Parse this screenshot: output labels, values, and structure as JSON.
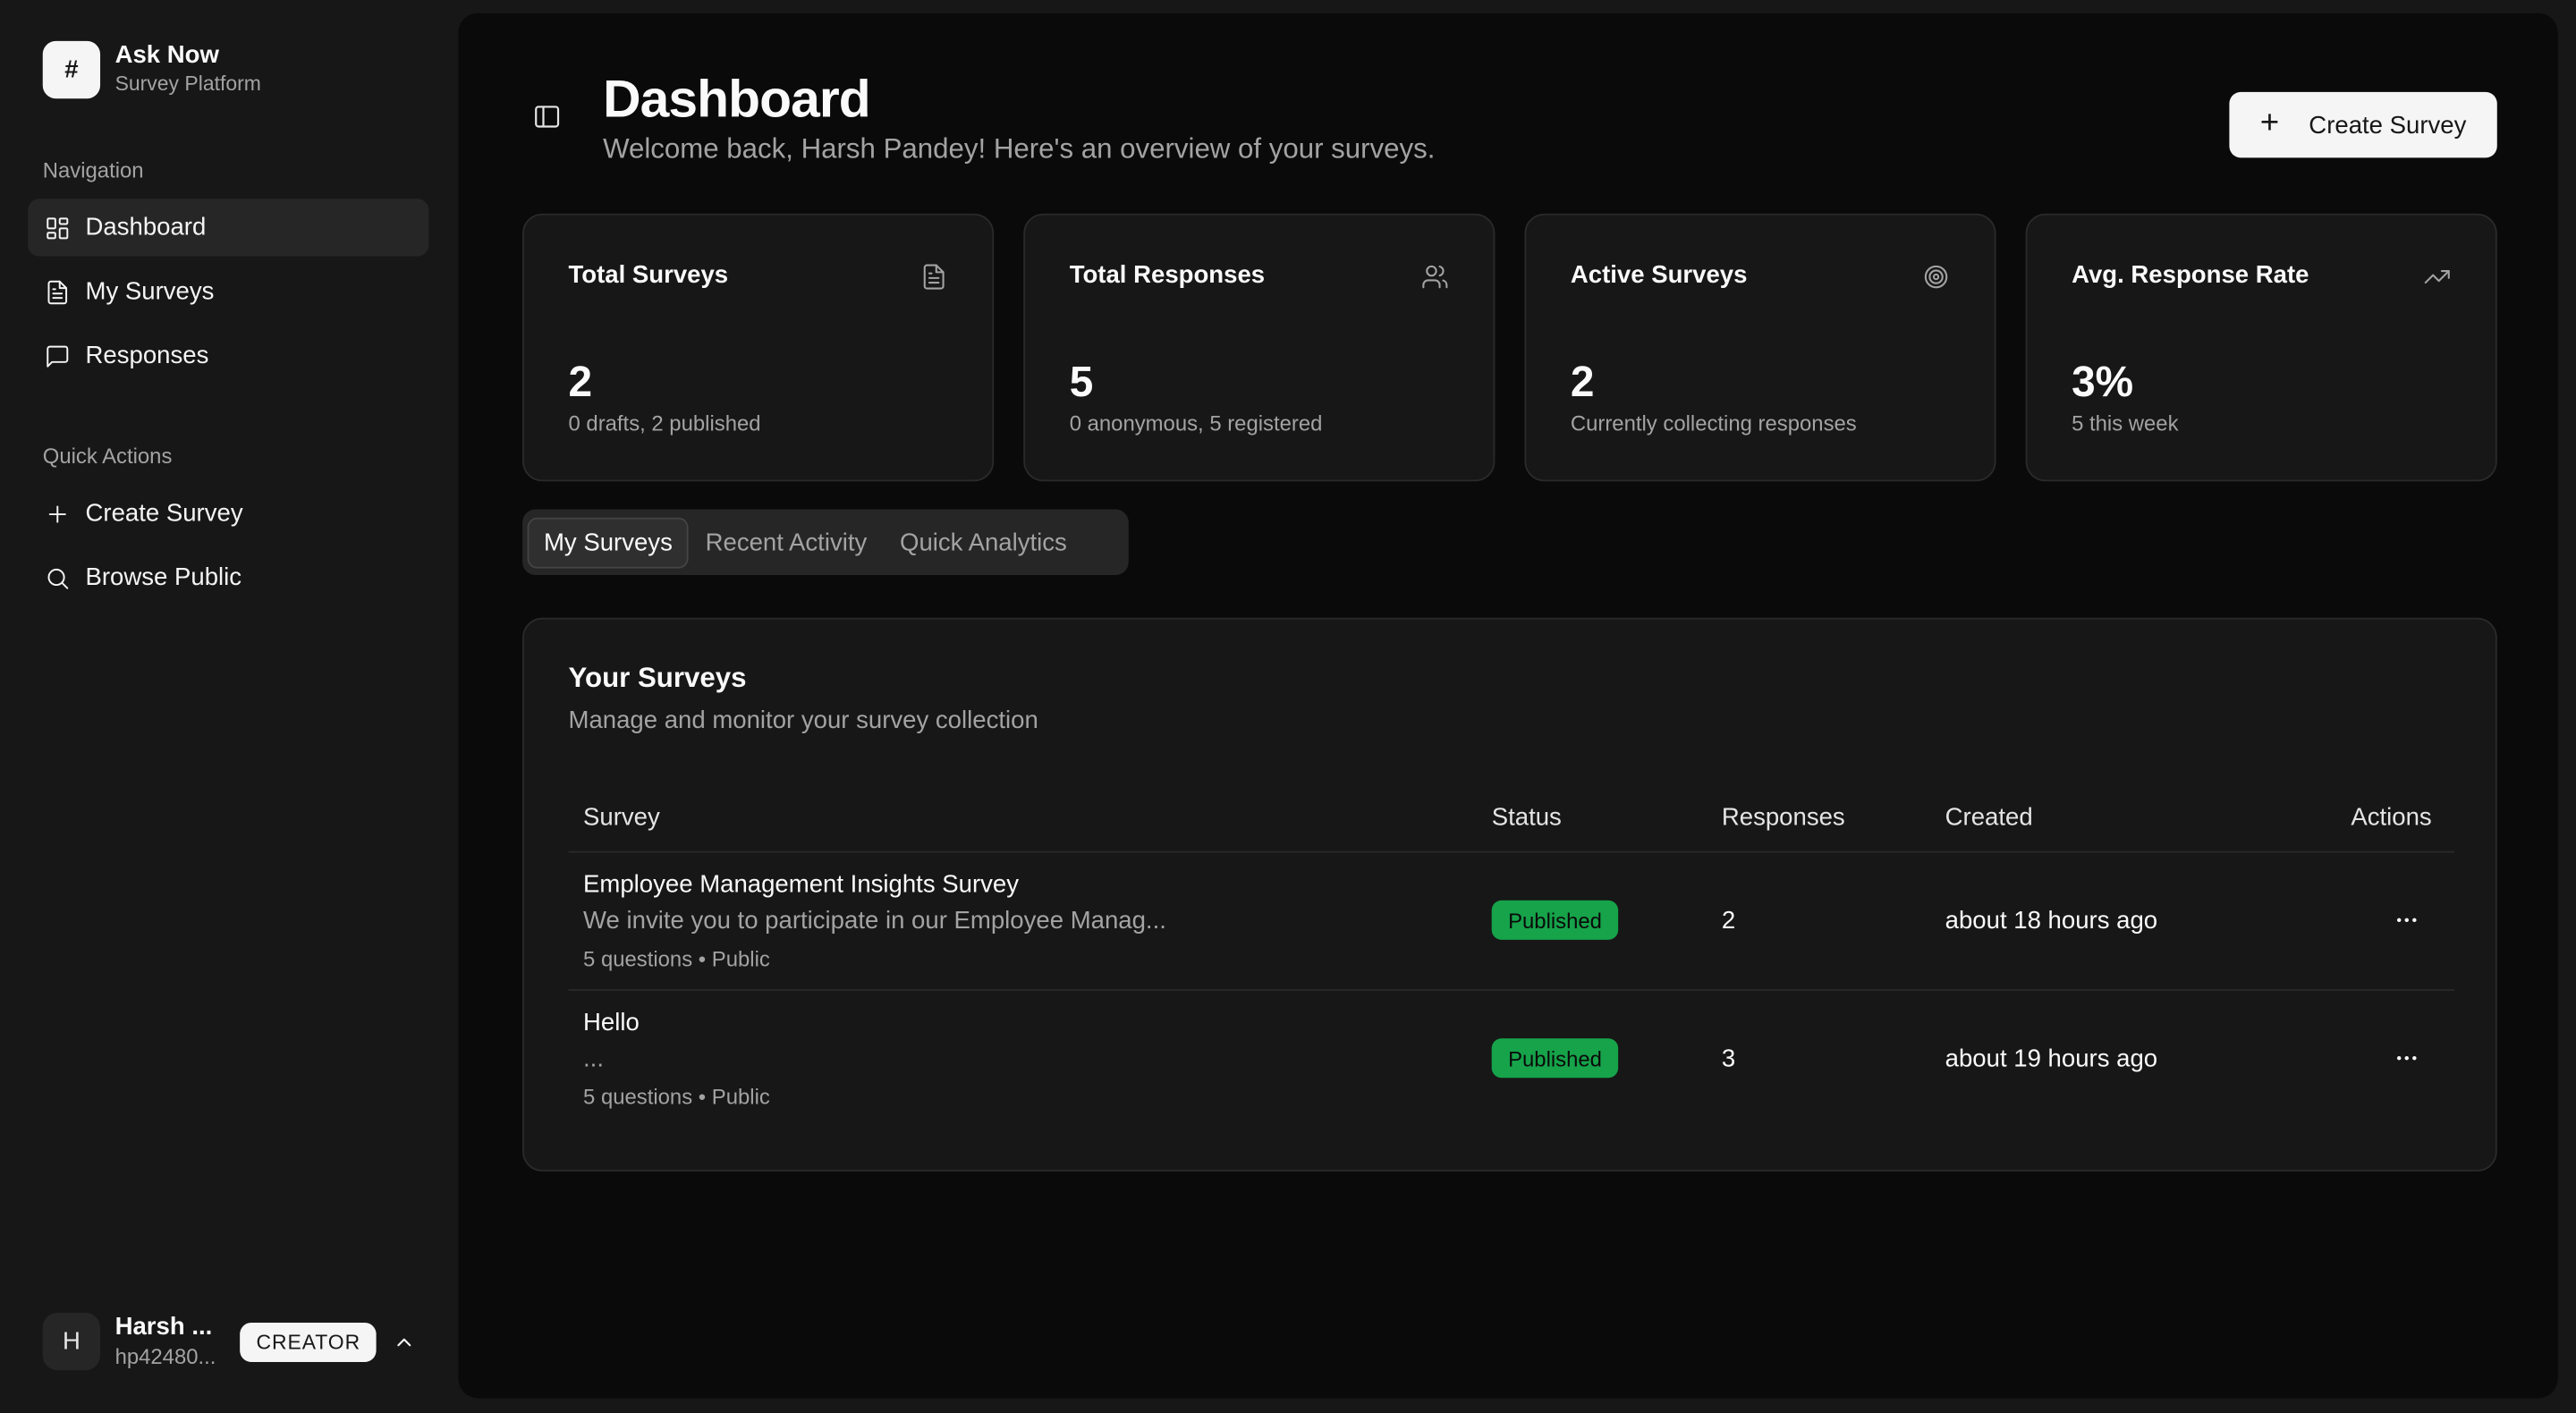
{
  "brand": {
    "logo": "#",
    "name": "Ask Now",
    "subtitle": "Survey Platform"
  },
  "sidebar": {
    "navigation_label": "Navigation",
    "nav_items": [
      {
        "label": "Dashboard",
        "icon": "dashboard-icon",
        "active": true
      },
      {
        "label": "My Surveys",
        "icon": "document-icon"
      },
      {
        "label": "Responses",
        "icon": "message-icon"
      }
    ],
    "quick_actions_label": "Quick Actions",
    "quick_actions": [
      {
        "label": "Create Survey",
        "icon": "plus-icon"
      },
      {
        "label": "Browse Public",
        "icon": "search-icon"
      }
    ]
  },
  "user": {
    "initial": "H",
    "name": "Harsh ...",
    "email": "hp42480...",
    "role": "CREATOR"
  },
  "header": {
    "title": "Dashboard",
    "subtitle": "Welcome back, Harsh Pandey! Here's an overview of your surveys.",
    "create_label": "Create Survey"
  },
  "stats": [
    {
      "title": "Total Surveys",
      "value": "2",
      "note": "0 drafts, 2 published",
      "icon": "file-icon"
    },
    {
      "title": "Total Responses",
      "value": "5",
      "note": "0 anonymous, 5 registered",
      "icon": "users-icon"
    },
    {
      "title": "Active Surveys",
      "value": "2",
      "note": "Currently collecting responses",
      "icon": "target-icon"
    },
    {
      "title": "Avg. Response Rate",
      "value": "3%",
      "note": "5 this week",
      "icon": "trending-up-icon"
    }
  ],
  "tabs": [
    "My Surveys",
    "Recent Activity",
    "Quick Analytics"
  ],
  "surveys": {
    "title": "Your Surveys",
    "subtitle": "Manage and monitor your survey collection",
    "columns": [
      "Survey",
      "Status",
      "Responses",
      "Created",
      "Actions"
    ],
    "rows": [
      {
        "title": "Employee Management Insights Survey",
        "description": "We invite you to participate in our Employee Manag...",
        "meta": "5 questions • Public",
        "status": "Published",
        "responses": "2",
        "created": "about 18 hours ago"
      },
      {
        "title": "Hello",
        "description": "...",
        "meta": "5 questions • Public",
        "status": "Published",
        "responses": "3",
        "created": "about 19 hours ago"
      }
    ]
  },
  "colors": {
    "background": "#0a0a0a",
    "sidebar": "#171717",
    "accent": "#f5f5f5",
    "published": "#16a34a"
  }
}
